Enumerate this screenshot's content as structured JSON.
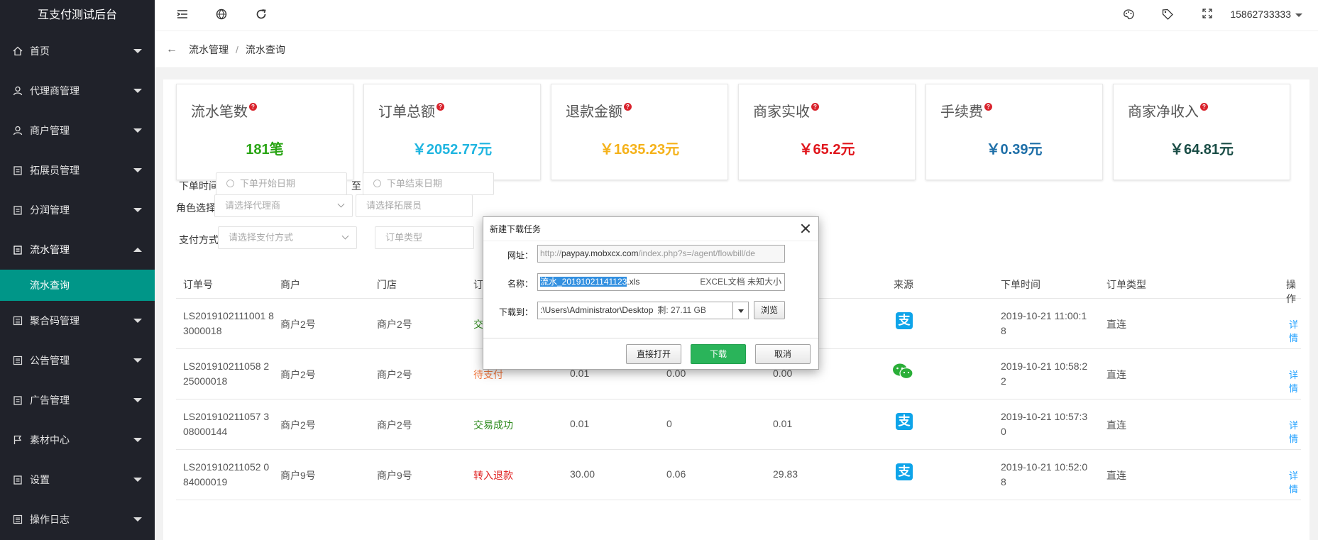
{
  "app": {
    "title": "互支付测试后台"
  },
  "sidebar": {
    "items": [
      {
        "label": "首页",
        "icon": "home-icon"
      },
      {
        "label": "代理商管理",
        "icon": "user-icon"
      },
      {
        "label": "商户管理",
        "icon": "user-icon"
      },
      {
        "label": "拓展员管理",
        "icon": "clipboard-icon"
      },
      {
        "label": "分润管理",
        "icon": "clipboard-icon"
      },
      {
        "label": "流水管理",
        "icon": "clipboard-icon",
        "expanded": true
      },
      {
        "label": "聚合码管理",
        "icon": "list-icon"
      },
      {
        "label": "公告管理",
        "icon": "list-icon"
      },
      {
        "label": "广告管理",
        "icon": "clipboard-icon"
      },
      {
        "label": "素材中心",
        "icon": "flag-icon"
      },
      {
        "label": "设置",
        "icon": "clipboard-icon"
      },
      {
        "label": "操作日志",
        "icon": "list-icon"
      }
    ],
    "active_sub": "流水查询"
  },
  "header": {
    "tools_left": [
      "menu-fold-icon",
      "website-icon",
      "refresh-icon"
    ],
    "tools_right": [
      "theme-icon",
      "tag-icon",
      "fullscreen-icon"
    ],
    "user": "15862733333"
  },
  "breadcrumb": {
    "items": [
      "流水管理",
      "流水查询"
    ]
  },
  "stats": [
    {
      "title": "流水笔数",
      "value": "181笔",
      "color": "#2aa515"
    },
    {
      "title": "订单总额",
      "value": "￥2052.77元",
      "color": "#1fb5e0"
    },
    {
      "title": "退款金额",
      "value": "￥1635.23元",
      "color": "#f5b21a"
    },
    {
      "title": "商家实收",
      "value": "￥65.2元",
      "color": "#e0161c"
    },
    {
      "title": "手续费",
      "value": "￥0.39元",
      "color": "#1e6fa8"
    },
    {
      "title": "商家净收入",
      "value": "￥64.81元",
      "color": "#1a4d46"
    }
  ],
  "filters": {
    "order_time_label": "下单时间",
    "start_placeholder": "下单开始日期",
    "to_label": "至",
    "end_placeholder": "下单结束日期",
    "role_label": "角色选择",
    "agent_placeholder": "请选择代理商",
    "promoter_placeholder": "请选择拓展员",
    "pay_method_label": "支付方式",
    "pay_method_placeholder": "请选择支付方式",
    "order_type_placeholder": "订单类型"
  },
  "table": {
    "headers": [
      "订单号",
      "商户",
      "门店",
      "订",
      "来源",
      "下单时间",
      "订单类型",
      "操作"
    ],
    "rows": [
      {
        "order_no": "LS2019102111001 83000018",
        "merchant": "商户2号",
        "store": "商户2号",
        "status": "交",
        "status_class": "status-success",
        "amount": "",
        "fee": "",
        "net": "",
        "source": "alipay",
        "time": "2019-10-21 11:00:1 8",
        "type": "直连",
        "action": "详情"
      },
      {
        "order_no": "LS201910211058 225000018",
        "merchant": "商户2号",
        "store": "商户2号",
        "status": "待支付",
        "status_class": "status-pending",
        "amount": "0.01",
        "fee": "0.00",
        "net": "0.00",
        "source": "wechat",
        "time": "2019-10-21 10:58:2 2",
        "type": "直连",
        "action": "详情"
      },
      {
        "order_no": "LS201910211057 308000144",
        "merchant": "商户2号",
        "store": "商户2号",
        "status": "交易成功",
        "status_class": "status-success",
        "amount": "0.01",
        "fee": "0",
        "net": "0.01",
        "source": "alipay",
        "time": "2019-10-21 10:57:3 0",
        "type": "直连",
        "action": "详情"
      },
      {
        "order_no": "LS201910211052 084000019",
        "merchant": "商户9号",
        "store": "商户9号",
        "status": "转入退款",
        "status_class": "status-refund",
        "amount": "30.00",
        "fee": "0.06",
        "net": "29.83",
        "source": "alipay",
        "time": "2019-10-21 10:52:0 8",
        "type": "直连",
        "action": "详情"
      }
    ]
  },
  "dialog": {
    "title": "新建下载任务",
    "url_label": "网址：",
    "url_prefix": "http://",
    "url_host": "paypay.mobxcx.com",
    "url_rest": "/index.php?s=/agent/flowbill/de",
    "name_label": "名称：",
    "name_selected": "流水_20191021141123",
    "name_ext": ".xls",
    "file_info": "EXCEL文档 未知大小",
    "save_label": "下载到：",
    "save_path": ":\\Users\\Administrator\\Desktop",
    "free_space": "剩: 27.11 GB",
    "browse": "浏览",
    "open_direct": "直接打开",
    "download": "下载",
    "cancel": "取消"
  }
}
